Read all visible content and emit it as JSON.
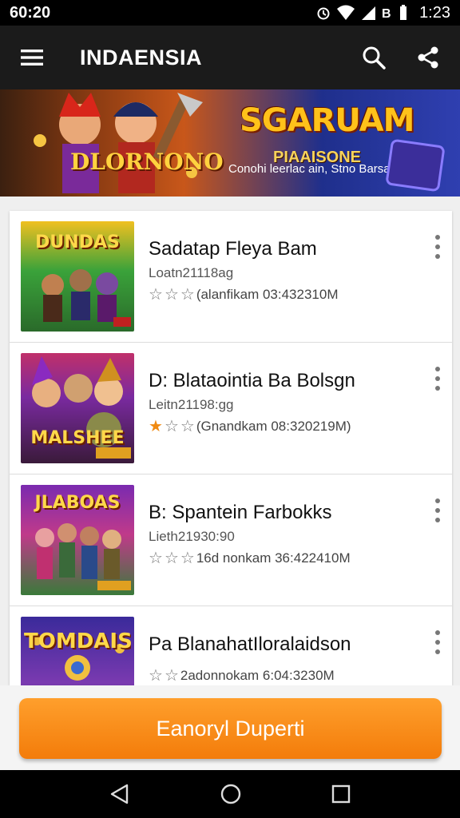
{
  "status_bar": {
    "left_time": "60:20",
    "right_time": "1:23"
  },
  "app_bar": {
    "title": "INDAENSIA"
  },
  "banner": {
    "title": "SGARUAM",
    "subtitle": "PIAAISONE",
    "caption": "Conohi leerlac ain, Stno Barsahi",
    "logo": "DLORNONO"
  },
  "games": [
    {
      "thumb_label": "DUNDAS",
      "title": "Sadatap Fleya Bam",
      "meta": "Loatn21118ag",
      "rating": "(alanfikam 03:432310M",
      "stars": [
        false,
        false,
        false
      ]
    },
    {
      "thumb_label": "MALSHEE",
      "title": "D: Blataointia Ba Bolsgn",
      "meta": "Leitn21198:gg",
      "rating": "(Gnandkam 08:320219M)",
      "stars": [
        true,
        false,
        false
      ]
    },
    {
      "thumb_label": "JLABOAS",
      "title": "B: Spantein Farbokks",
      "meta": "Lieth21930:90",
      "rating": "16d nonkam 36:422410M",
      "stars": [
        false,
        false,
        false
      ]
    },
    {
      "thumb_label": "TOMDAIS",
      "title": "Pa BlanahatIloralaidson",
      "meta": "",
      "rating": "2adonnokam 6:04:3230M",
      "stars": [
        false,
        false,
        false
      ]
    }
  ],
  "cta": {
    "label": "Eanoryl Duperti"
  },
  "colors": {
    "accent": "#f37c0a",
    "appbar": "#1b1b1b",
    "star_filled": "#f08a12"
  }
}
